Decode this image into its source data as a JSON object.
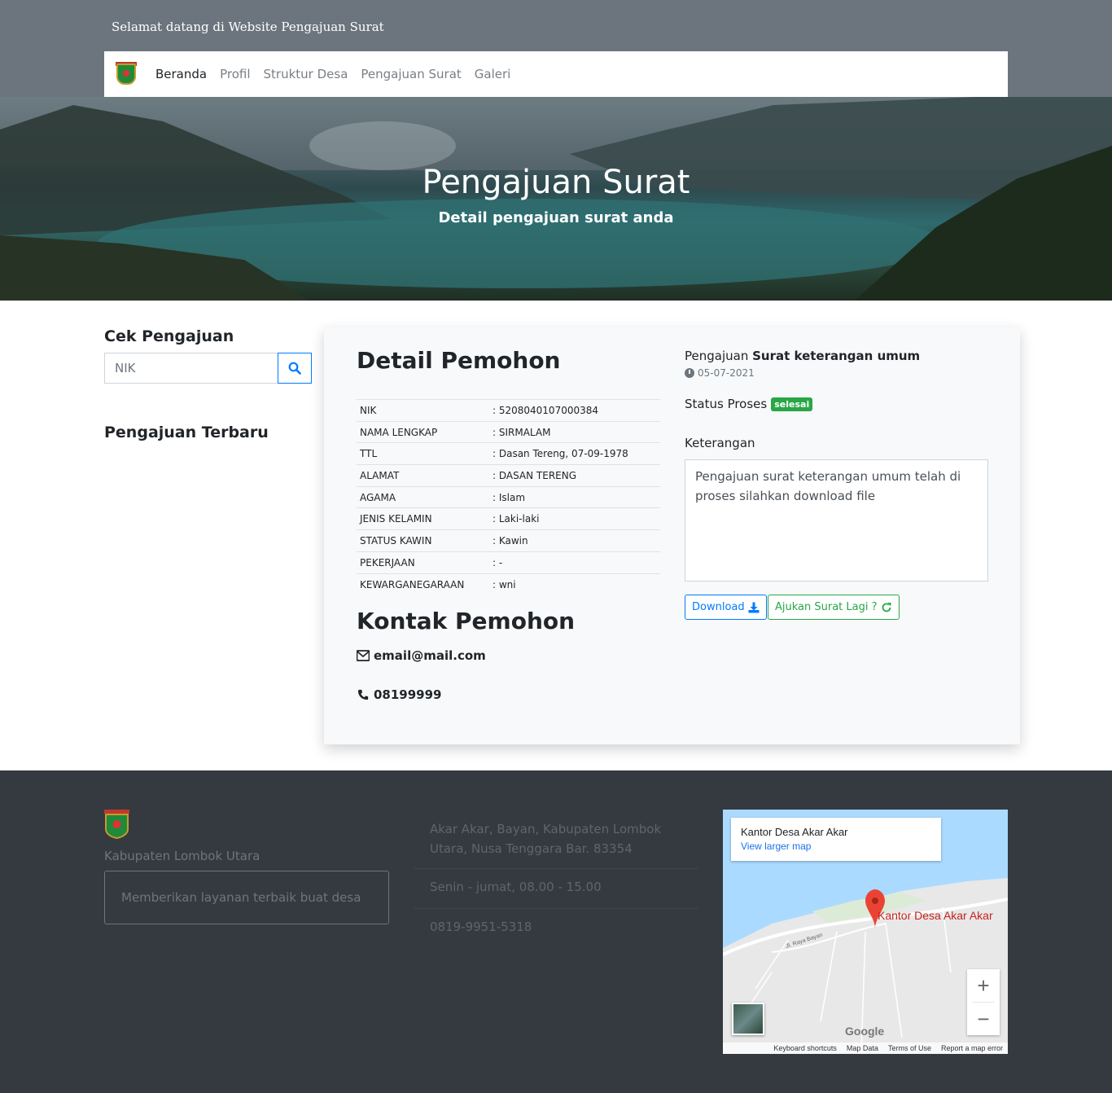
{
  "header": {
    "welcome": "Selamat datang di Website Pengajuan Surat"
  },
  "nav": {
    "items": [
      "Beranda",
      "Profil",
      "Struktur Desa",
      "Pengajuan Surat",
      "Galeri"
    ],
    "active": "Beranda"
  },
  "hero": {
    "title": "Pengajuan Surat",
    "subtitle": "Detail pengajuan surat anda"
  },
  "sidebar": {
    "cek_title": "Cek Pengajuan",
    "search_placeholder": "NIK",
    "terbaru_title": "Pengajuan Terbaru",
    "search_icon": "search-icon"
  },
  "detail": {
    "title": "Detail Pemohon",
    "rows": [
      {
        "label": "NIK",
        "value": ": 5208040107000384"
      },
      {
        "label": "NAMA LENGKAP",
        "value": ": SIRMALAM"
      },
      {
        "label": "TTL",
        "value": ": Dasan Tereng, 07-09-1978"
      },
      {
        "label": "ALAMAT",
        "value": ": DASAN TERENG"
      },
      {
        "label": "AGAMA",
        "value": ": Islam"
      },
      {
        "label": "JENIS KELAMIN",
        "value": ": Laki-laki"
      },
      {
        "label": "STATUS KAWIN",
        "value": ": Kawin"
      },
      {
        "label": "PEKERJAAN",
        "value": ": -"
      },
      {
        "label": "KEWARGANEGARAAN",
        "value": ": wni"
      }
    ]
  },
  "kontak": {
    "title": "Kontak Pemohon",
    "email": "email@mail.com",
    "phone": "08199999"
  },
  "pengajuan": {
    "prefix": "Pengajuan",
    "jenis": "Surat keterangan umum",
    "date": "05-07-2021",
    "status_label": "Status Proses",
    "status_badge": "selesai",
    "ket_label": "Keterangan",
    "ket_text": "Pengajuan surat keterangan umum telah di proses silahkan download file",
    "download_label": "Download",
    "again_label": "Ajukan Surat Lagi ?"
  },
  "footer": {
    "name": "Kabupaten Lombok Utara",
    "tagline": "Memberikan layanan terbaik buat desa",
    "address": "Akar Akar, Bayan, Kabupaten Lombok Utara, Nusa Tenggara Bar. 83354",
    "hours": "Senin - jumat, 08.00 - 15.00",
    "phone": "0819-9951-5318"
  },
  "map": {
    "place_title": "Kantor Desa Akar Akar",
    "larger_link": "View larger map",
    "marker_label": "Kantor Desa Akar Akar",
    "road_label": "Jl. Raya Bayan",
    "brand": "Google",
    "zoom_in": "+",
    "zoom_out": "−",
    "footer_links": [
      "Keyboard shortcuts",
      "Map Data",
      "Terms of Use",
      "Report a map error"
    ]
  },
  "colors": {
    "primary": "#007bff",
    "success": "#28a745",
    "footer_bg": "#343a40",
    "topbar_bg": "#6c757d"
  }
}
